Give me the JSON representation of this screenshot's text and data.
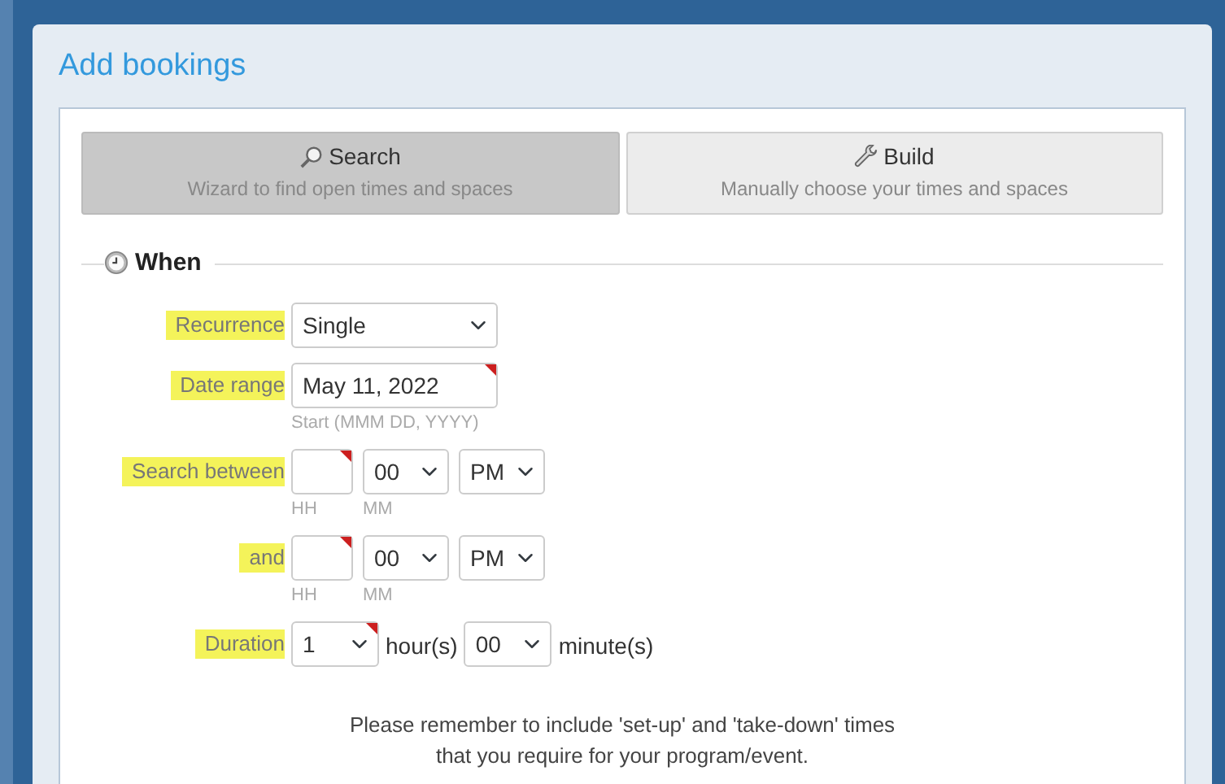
{
  "dialog": {
    "title": "Add bookings"
  },
  "tabs": [
    {
      "kind": "search",
      "label": "Search",
      "description": "Wizard to find open times and spaces",
      "selected": true
    },
    {
      "kind": "build",
      "label": "Build",
      "description": "Manually choose your times and spaces",
      "selected": false
    }
  ],
  "section": {
    "title": "When"
  },
  "rows": [
    {
      "kind": "select",
      "label": "Recurrence",
      "highlighted": true,
      "field": {
        "value": "Single"
      }
    },
    {
      "kind": "date",
      "label": "Date range",
      "highlighted": true,
      "field": {
        "value": "May 11, 2022",
        "required": true,
        "hint": "Start (MMM DD, YYYY)"
      }
    },
    {
      "kind": "time",
      "label": "Search between",
      "highlighted": true,
      "hour": {
        "required": true,
        "hint": "HH"
      },
      "minute": {
        "value": "00",
        "hint": "MM"
      },
      "ampm": {
        "value": "PM"
      }
    },
    {
      "kind": "time",
      "label": "and",
      "highlighted": true,
      "hour": {
        "required": true,
        "hint": "HH"
      },
      "minute": {
        "value": "00",
        "hint": "MM"
      },
      "ampm": {
        "value": "PM"
      }
    },
    {
      "kind": "duration",
      "label": "Duration",
      "highlighted": true,
      "hours": {
        "value": "1",
        "required": true
      },
      "hours_unit": "hour(s)",
      "minutes": {
        "value": "00"
      },
      "minutes_unit": "minute(s)"
    }
  ],
  "notice": "Please remember to include 'set-up' and 'take-down' times\nthat you require for your program/event."
}
